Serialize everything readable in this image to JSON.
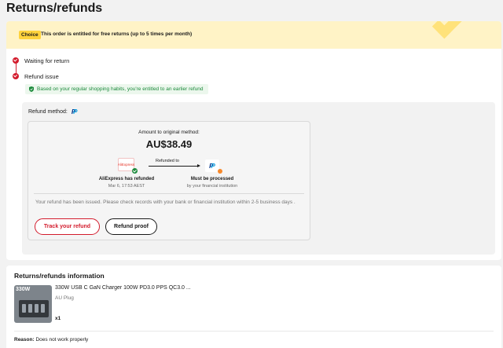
{
  "page": {
    "title": "Returns/refunds"
  },
  "banner": {
    "badge": "Choice",
    "text": "This order is entitled for free returns (up to 5 times per month)"
  },
  "timeline": {
    "steps": [
      {
        "label": "Waiting for return"
      },
      {
        "label": "Refund issue"
      }
    ]
  },
  "early_refund_note": "Based on your regular shopping habits, you're entitled to an earlier refund",
  "refund": {
    "method_label": "Refund method:",
    "method_icon": "paypal-icon",
    "amount_label": "Amount to original method:",
    "amount": "AU$38.49",
    "from_logo": "AliExpress",
    "arrow_label": "Refunded to",
    "from_title": "AliExpress has refunded",
    "from_time": "Mar 6, 17:53 AEST",
    "to_title": "Must be processed",
    "to_sub": "by your financial institution",
    "note": "Your refund has been issued. Please check records with your bank or financial institution within 2-5 business days .",
    "buttons": {
      "track": "Track your refund",
      "proof": "Refund proof"
    }
  },
  "info": {
    "title": "Returns/refunds information",
    "product": {
      "thumb_text": "330W",
      "name": "330W USB C GaN Charger 100W PD3.0 PPS QC3.0 ...",
      "variant": "AU Plug",
      "quantity": "x1"
    },
    "reason_label": "Reason:",
    "reason_value": "Does not work properly"
  },
  "colors": {
    "accent_red": "#d31b2c",
    "success_green": "#1c8a3c",
    "banner_yellow": "#fff3c6",
    "choice_yellow": "#ffd33d"
  }
}
